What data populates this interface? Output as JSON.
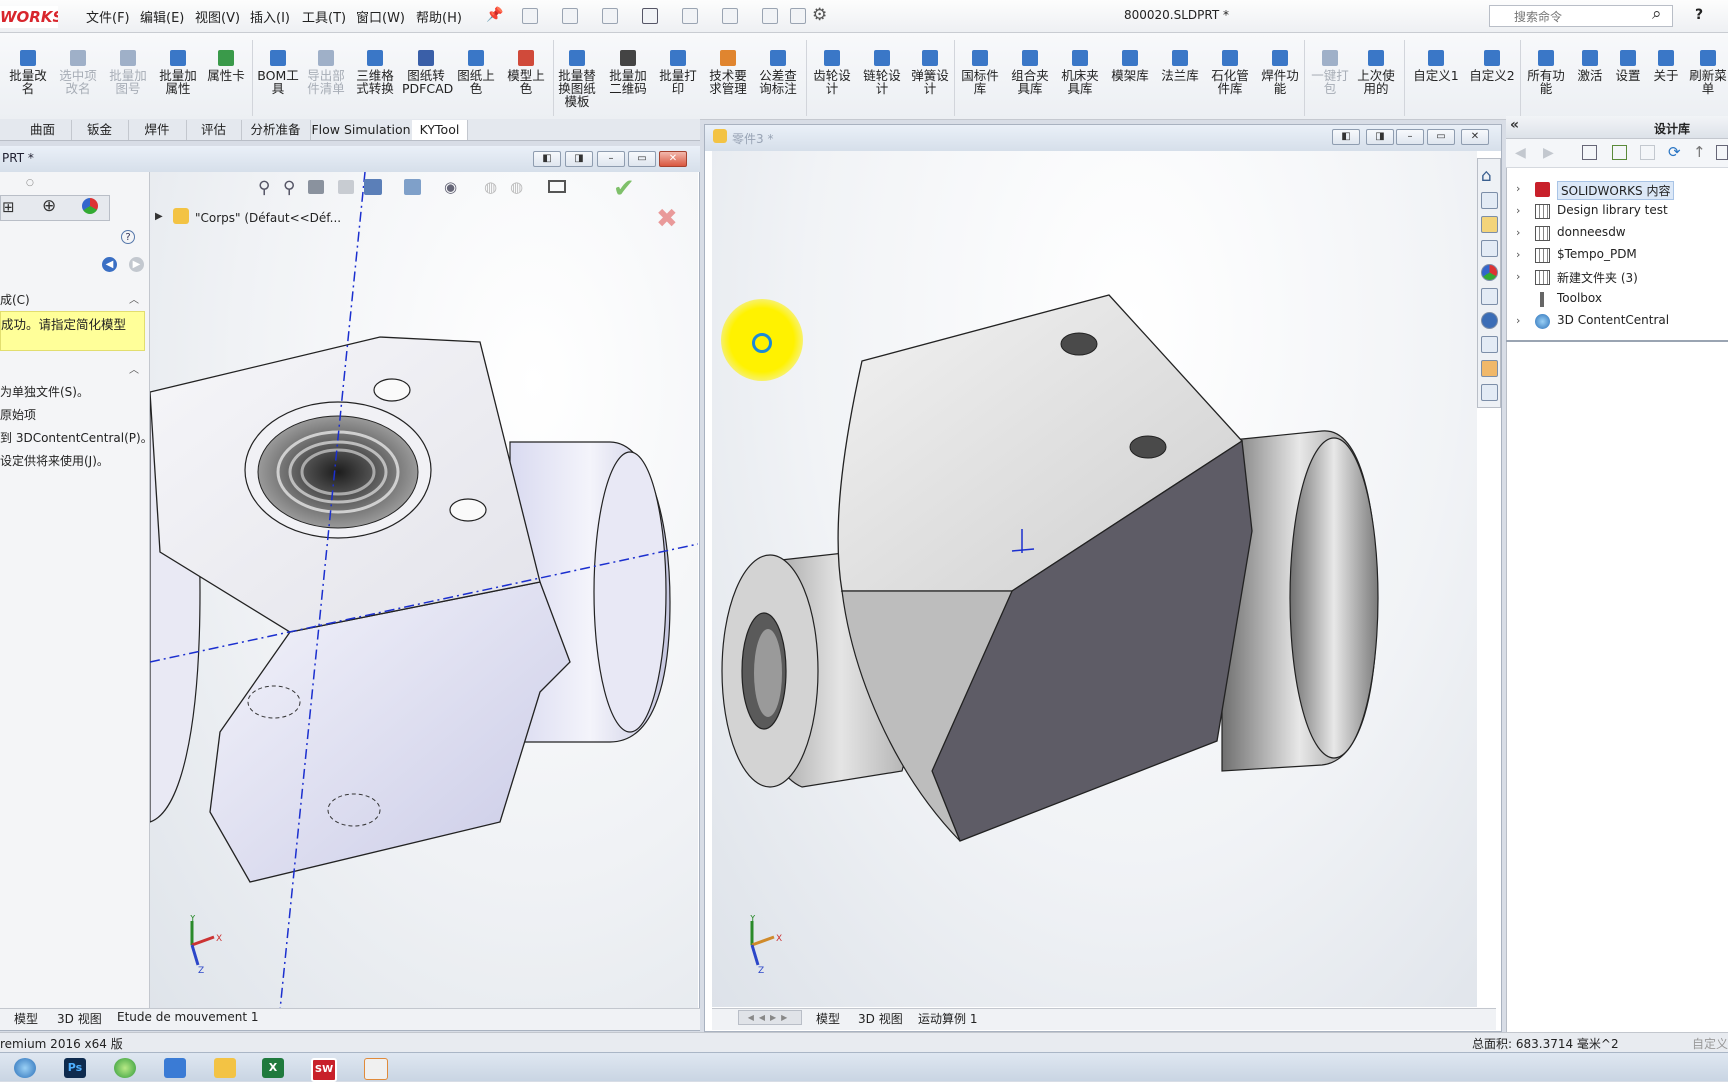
{
  "app": {
    "logo_text": "WORKS",
    "document_title": "800020.SLDPRT *",
    "search_placeholder": "搜索命令",
    "help_label": "?"
  },
  "menu": [
    "文件(F)",
    "编辑(E)",
    "视图(V)",
    "插入(I)",
    "工具(T)",
    "窗口(W)",
    "帮助(H)"
  ],
  "ribbon": [
    {
      "label": "批量改\n名",
      "enabled": true,
      "color": "#3a77c7"
    },
    {
      "label": "选中项\n改名",
      "enabled": false,
      "color": "#9fb0c8"
    },
    {
      "label": "批量加\n图号",
      "enabled": false,
      "color": "#9fb0c8"
    },
    {
      "label": "批量加\n属性",
      "enabled": true,
      "color": "#3a77c7"
    },
    {
      "label": "属性卡",
      "enabled": true,
      "color": "#3a9a4a"
    },
    {
      "label": "BOM工\n具",
      "enabled": true,
      "color": "#3a77c7"
    },
    {
      "label": "导出部\n件清单",
      "enabled": false,
      "color": "#9fb0c8"
    },
    {
      "label": "三维格\n式转换",
      "enabled": true,
      "color": "#3a77c7"
    },
    {
      "label": "图纸转\nPDFCAD",
      "enabled": true,
      "color": "#3a5fa8"
    },
    {
      "label": "图纸上\n色",
      "enabled": true,
      "color": "#3a77c7"
    },
    {
      "label": "模型上\n色",
      "enabled": true,
      "color": "#d04a3a"
    },
    {
      "label": "批量替\n换图纸\n模板",
      "enabled": true,
      "color": "#3a77c7"
    },
    {
      "label": "批量加\n二维码",
      "enabled": true,
      "color": "#444444"
    },
    {
      "label": "批量打\n印",
      "enabled": true,
      "color": "#3a77c7"
    },
    {
      "label": "技术要\n求管理",
      "enabled": true,
      "color": "#e0852f"
    },
    {
      "label": "公差查\n询标注",
      "enabled": true,
      "color": "#3a77c7"
    },
    {
      "label": "齿轮设\n计",
      "enabled": true,
      "color": "#3a77c7"
    },
    {
      "label": "链轮设\n计",
      "enabled": true,
      "color": "#3a77c7"
    },
    {
      "label": "弹簧设\n计",
      "enabled": true,
      "color": "#3a77c7"
    },
    {
      "label": "国标件\n库",
      "enabled": true,
      "color": "#3a77c7"
    },
    {
      "label": "组合夹\n具库",
      "enabled": true,
      "color": "#3a77c7"
    },
    {
      "label": "机床夹\n具库",
      "enabled": true,
      "color": "#3a77c7"
    },
    {
      "label": "模架库",
      "enabled": true,
      "color": "#3a77c7"
    },
    {
      "label": "法兰库",
      "enabled": true,
      "color": "#3a77c7"
    },
    {
      "label": "石化管\n件库",
      "enabled": true,
      "color": "#3a77c7"
    },
    {
      "label": "焊件功\n能",
      "enabled": true,
      "color": "#3a77c7"
    },
    {
      "label": "一键打\n包",
      "enabled": false,
      "color": "#9fb0c8"
    },
    {
      "label": "上次使\n用的",
      "enabled": true,
      "color": "#3a77c7"
    },
    {
      "label": "自定义1",
      "enabled": true,
      "color": "#3a77c7"
    },
    {
      "label": "自定义2",
      "enabled": true,
      "color": "#3a77c7"
    },
    {
      "label": "所有功\n能",
      "enabled": true,
      "color": "#3a77c7"
    },
    {
      "label": "激活",
      "enabled": true,
      "color": "#3a77c7"
    },
    {
      "label": "设置",
      "enabled": true,
      "color": "#3a77c7"
    },
    {
      "label": "关于",
      "enabled": true,
      "color": "#3a77c7"
    },
    {
      "label": "刷新菜\n单",
      "enabled": true,
      "color": "#3a77c7"
    }
  ],
  "command_tabs": [
    "曲面",
    "钣金",
    "焊件",
    "评估",
    "分析准备",
    "Flow Simulation",
    "KYTool"
  ],
  "left_window": {
    "title": "PRT *",
    "tree_item": "\"Corps\"  (Défaut<<Déf...",
    "section1_title": "成(C)",
    "message": "成功。请指定简化模型",
    "options": [
      "为单独文件(S)。",
      "原始项",
      "到 3DContentCentral(P)。",
      "设定供将来使用(J)。"
    ],
    "tabs": [
      "模型",
      "3D 视图",
      "Etude de mouvement 1"
    ]
  },
  "right_window": {
    "title": "零件3 *",
    "tabs": [
      "模型",
      "3D 视图",
      "运动算例 1"
    ]
  },
  "design_library": {
    "header": "设计库",
    "items": [
      {
        "label": "SOLIDWORKS 内容",
        "expandable": true,
        "selected": true,
        "icon": "solidworks-content-icon"
      },
      {
        "label": "Design library test",
        "expandable": true,
        "selected": false,
        "icon": "library-folder-icon"
      },
      {
        "label": "donneesdw",
        "expandable": true,
        "selected": false,
        "icon": "library-folder-icon"
      },
      {
        "label": "$Tempo_PDM",
        "expandable": true,
        "selected": false,
        "icon": "library-folder-icon"
      },
      {
        "label": "新建文件夹 (3)",
        "expandable": true,
        "selected": false,
        "icon": "library-folder-icon"
      },
      {
        "label": "Toolbox",
        "expandable": false,
        "selected": false,
        "icon": "toolbox-icon"
      },
      {
        "label": "3D ContentCentral",
        "expandable": true,
        "selected": false,
        "icon": "globe-icon"
      }
    ]
  },
  "status": {
    "version": "remium 2016 x64 版",
    "area": "总面积: 683.3714 毫米^2",
    "custom": "自定义"
  },
  "colors": {
    "accent": "#3a77c7",
    "brand_red": "#d8262d",
    "message_bg": "#ffff99",
    "cursor_highlight": "#fff200"
  }
}
